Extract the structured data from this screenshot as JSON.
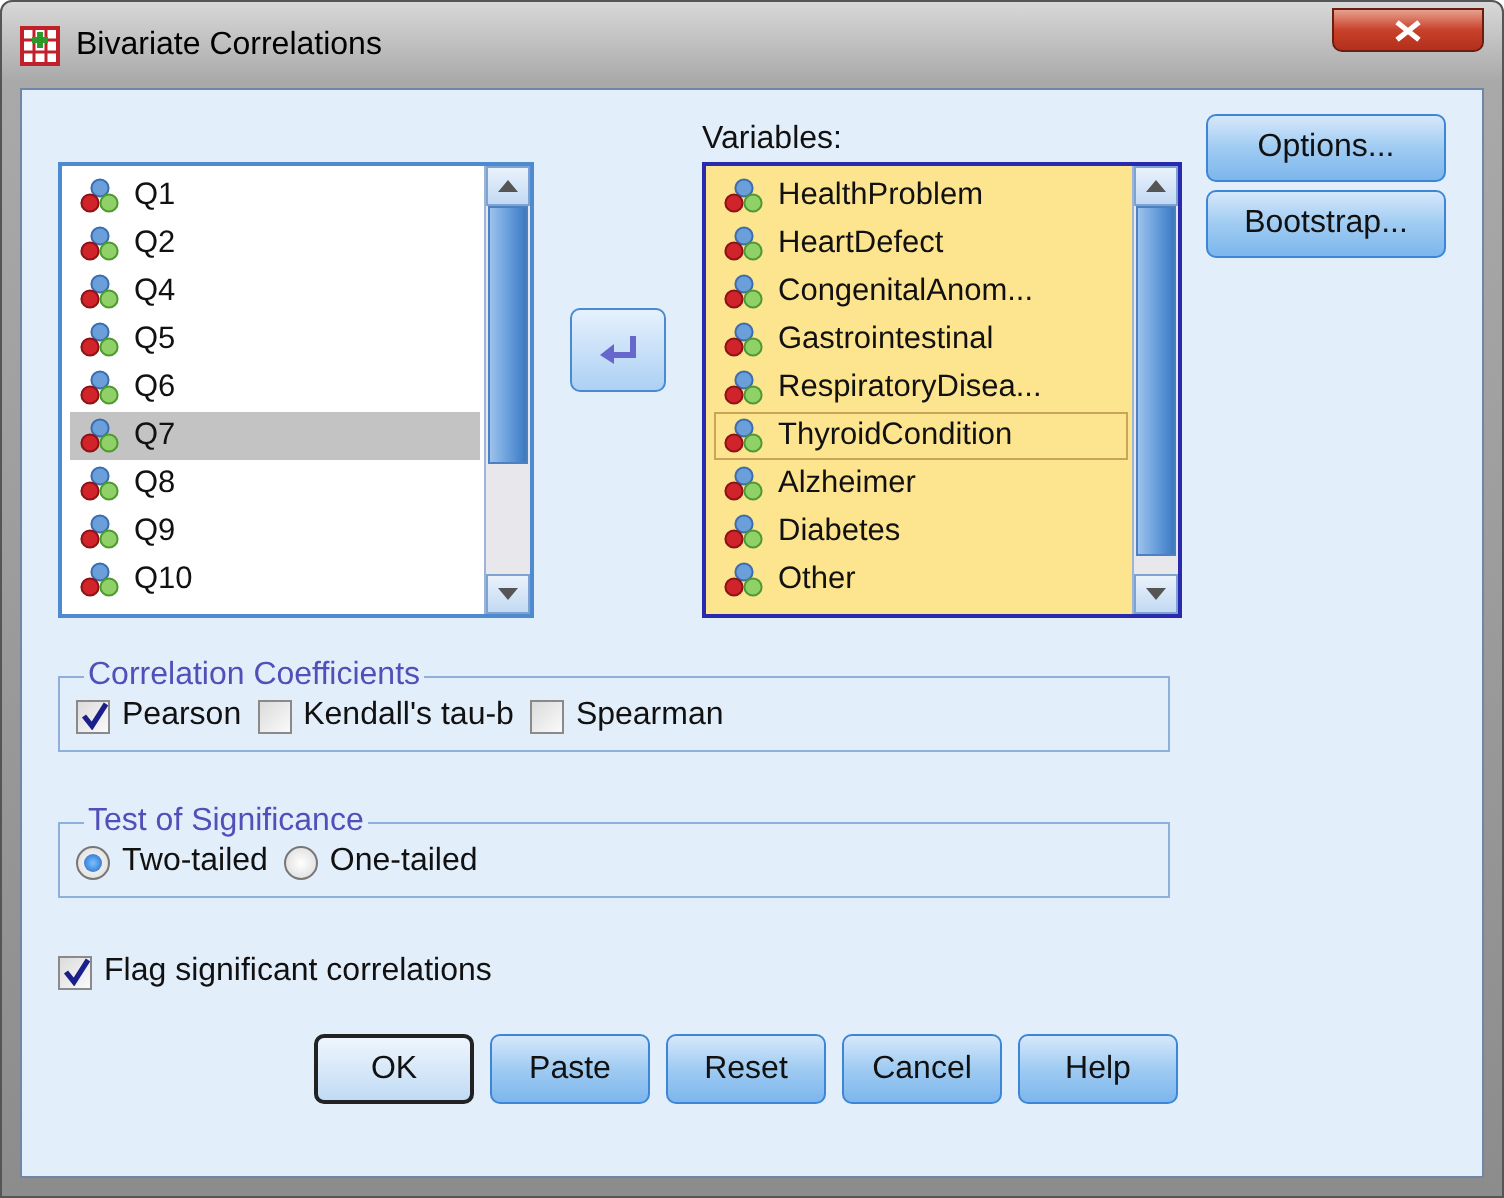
{
  "window": {
    "title": "Bivariate Correlations"
  },
  "source_list": {
    "items": [
      {
        "label": "Q1",
        "selected": false
      },
      {
        "label": "Q2",
        "selected": false
      },
      {
        "label": "Q4",
        "selected": false
      },
      {
        "label": "Q5",
        "selected": false
      },
      {
        "label": "Q6",
        "selected": false
      },
      {
        "label": "Q7",
        "selected": true
      },
      {
        "label": "Q8",
        "selected": false
      },
      {
        "label": "Q9",
        "selected": false
      },
      {
        "label": "Q10",
        "selected": false
      }
    ]
  },
  "variables": {
    "label": "Variables:",
    "items": [
      {
        "label": "HealthProblem",
        "focused": false
      },
      {
        "label": "HeartDefect",
        "focused": false
      },
      {
        "label": "CongenitalAnom...",
        "focused": false
      },
      {
        "label": "Gastrointestinal",
        "focused": false
      },
      {
        "label": "RespiratoryDisea...",
        "focused": false
      },
      {
        "label": "ThyroidCondition",
        "focused": true
      },
      {
        "label": "Alzheimer",
        "focused": false
      },
      {
        "label": "Diabetes",
        "focused": false
      },
      {
        "label": "Other",
        "focused": false
      }
    ]
  },
  "side_buttons": [
    "Options...",
    "Bootstrap..."
  ],
  "correlation_coefficients": {
    "title": "Correlation Coefficients",
    "options": [
      {
        "label": "Pearson",
        "checked": true
      },
      {
        "label": "Kendall's tau-b",
        "checked": false
      },
      {
        "label": "Spearman",
        "checked": false
      }
    ]
  },
  "test_of_significance": {
    "title": "Test of Significance",
    "options": [
      {
        "label": "Two-tailed",
        "selected": true
      },
      {
        "label": "One-tailed",
        "selected": false
      }
    ]
  },
  "flag": {
    "label": "Flag significant correlations",
    "checked": true
  },
  "buttons": [
    {
      "label": "OK",
      "default": true
    },
    {
      "label": "Paste",
      "default": false
    },
    {
      "label": "Reset",
      "default": false
    },
    {
      "label": "Cancel",
      "default": false
    },
    {
      "label": "Help",
      "default": false
    }
  ]
}
